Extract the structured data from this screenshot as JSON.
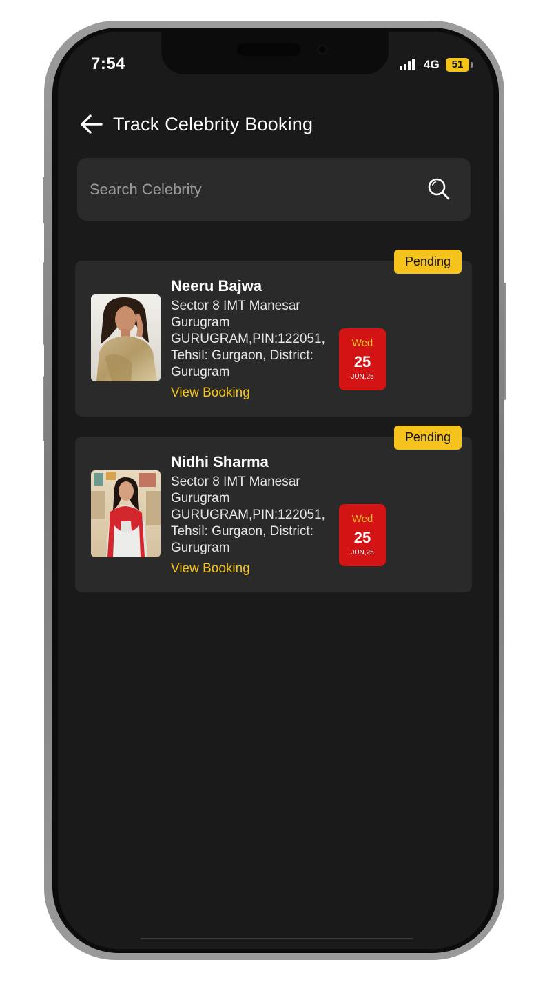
{
  "status_bar": {
    "time": "7:54",
    "network": "4G",
    "battery": "51"
  },
  "header": {
    "title": "Track Celebrity Booking",
    "back_icon": "arrow-left-icon"
  },
  "search": {
    "placeholder": "Search Celebrity",
    "value": "",
    "icon": "search-icon"
  },
  "bookings": [
    {
      "status": "Pending",
      "name": "Neeru Bajwa",
      "address": "Sector 8 IMT Manesar Gurugram GURUGRAM,PIN:122051, Tehsil: Gurgaon, District: Gurugram",
      "link_label": "View Booking",
      "date": {
        "weekday": "Wed",
        "day": "25",
        "month_year": "JUN,25"
      }
    },
    {
      "status": "Pending",
      "name": "Nidhi Sharma",
      "address": "Sector 8 IMT Manesar Gurugram GURUGRAM,PIN:122051, Tehsil: Gurgaon, District: Gurugram",
      "link_label": "View Booking",
      "date": {
        "weekday": "Wed",
        "day": "25",
        "month_year": "JUN,25"
      }
    }
  ],
  "colors": {
    "background": "#1a1a1a",
    "card": "#2a2a2a",
    "accent": "#f6c31c",
    "date_tile": "#d41414"
  }
}
